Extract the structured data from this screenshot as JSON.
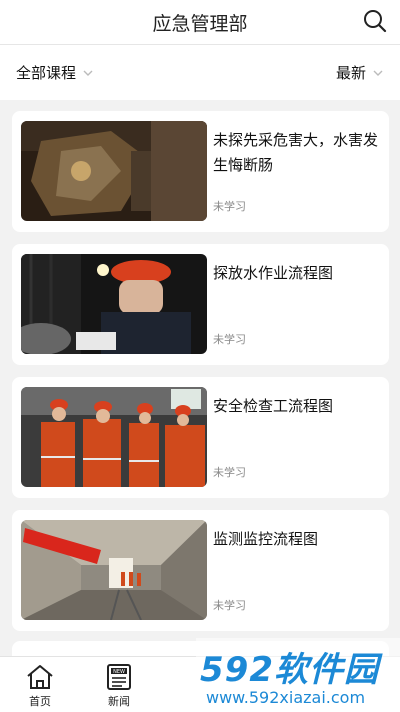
{
  "header": {
    "title": "应急管理部"
  },
  "filters": {
    "category": "全部课程",
    "sort": "最新"
  },
  "courses": [
    {
      "title": "未探先采危害大，水害发生悔断肠",
      "status": "未学习"
    },
    {
      "title": "探放水作业流程图",
      "status": "未学习"
    },
    {
      "title": "安全检查工流程图",
      "status": "未学习"
    },
    {
      "title": "监测监控流程图",
      "status": "未学习"
    }
  ],
  "tabs": [
    {
      "label": "首页"
    },
    {
      "label": "新闻"
    }
  ],
  "watermark": {
    "brand": "592软件园",
    "url": "www.592xiazai.com"
  }
}
